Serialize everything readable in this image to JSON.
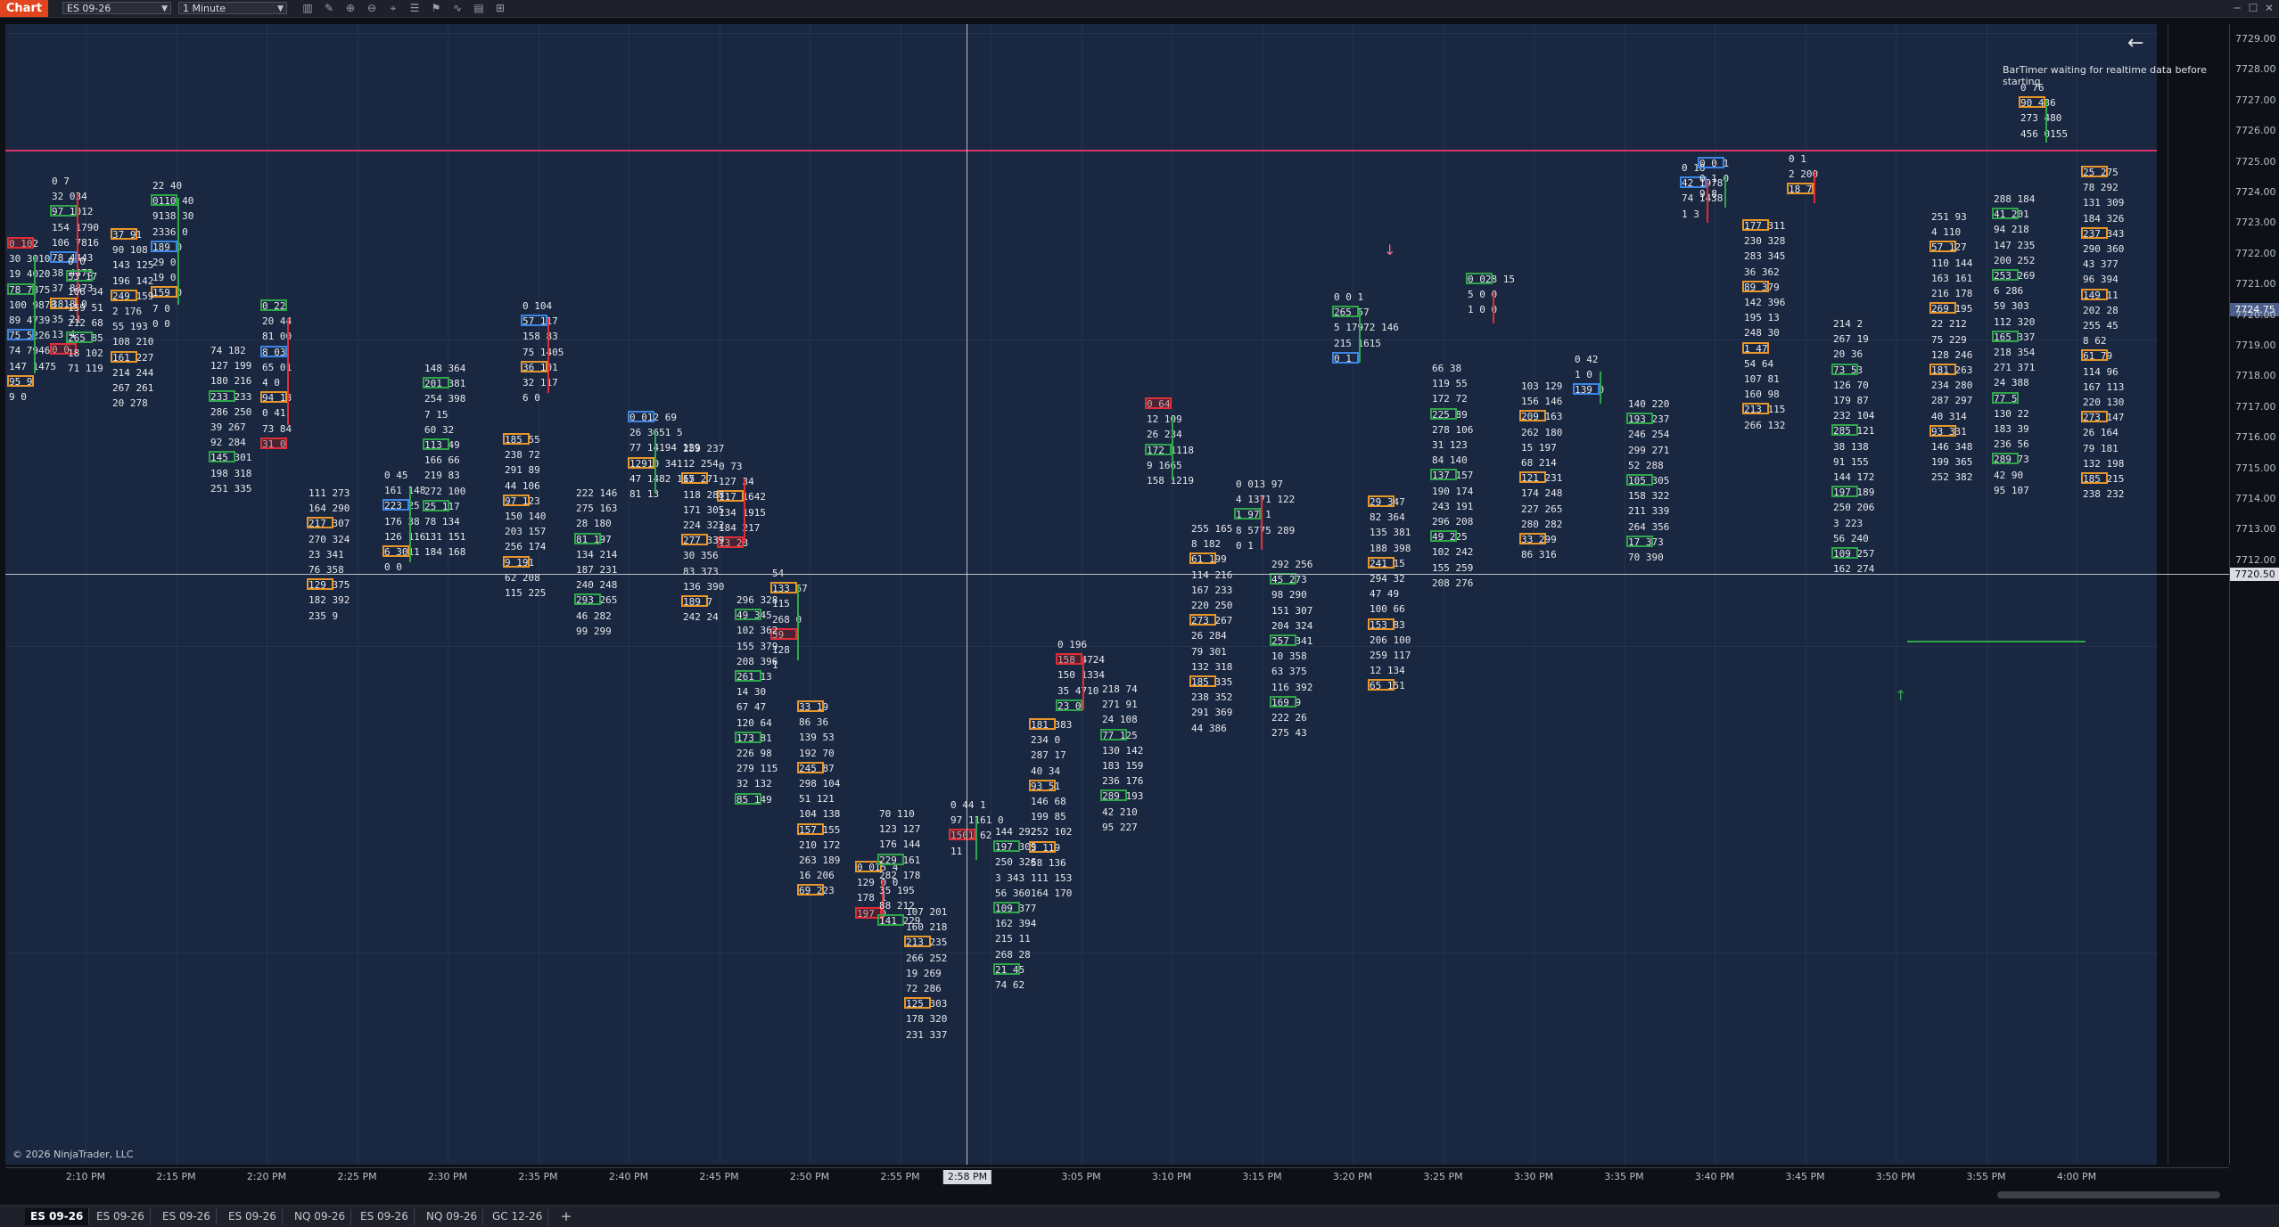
{
  "toolbar": {
    "chart_tab": "Chart",
    "instrument": "ES 09-26",
    "interval": "1 Minute",
    "icons": [
      "bar-style-icon",
      "draw-pencil-icon",
      "zoom-in-icon",
      "zoom-out-icon",
      "crosshair-icon",
      "properties-icon",
      "strategy-icon",
      "indicator-icon",
      "template-icon",
      "data-box-icon"
    ]
  },
  "chart": {
    "copyright": "© 2026 NinjaTrader, LLC",
    "bartimer": "BarTimer waiting for realtime data before starting",
    "price_labels": [
      "7729.00",
      "7728.00",
      "7727.00",
      "7726.00",
      "7725.00",
      "7724.00",
      "7723.00",
      "7722.00",
      "7721.00",
      "7720.00",
      "7719.00",
      "7718.00",
      "7717.00",
      "7716.00",
      "7715.00",
      "7714.00",
      "7713.00",
      "7712.00"
    ],
    "price_marker": "7724.75",
    "cursor_price": "7720.50",
    "time_labels": [
      "2:10 PM",
      "2:15 PM",
      "2:20 PM",
      "2:25 PM",
      "2:30 PM",
      "2:35 PM",
      "2:40 PM",
      "2:45 PM",
      "2:50 PM",
      "2:55 PM",
      "3:00 PM",
      "3:05 PM",
      "3:10 PM",
      "3:15 PM",
      "3:20 PM",
      "3:25 PM",
      "3:30 PM",
      "3:35 PM",
      "3:40 PM",
      "3:45 PM",
      "3:50 PM",
      "3:55 PM",
      "4:00 PM"
    ],
    "cursor_time": "2:58 PM",
    "colors": {
      "background": "#1a2740",
      "sell_imbalance": "#e12d35",
      "buy_imbalance": "#2fa64a",
      "poc": "#e9962a",
      "value": "#3c87e6",
      "level_line": "#d6336c"
    }
  },
  "tabs": [
    "ES 09-26",
    "ES 09-26",
    "ES 09-26",
    "ES 09-26",
    "NQ 09-26",
    "ES 09-26",
    "NQ 09-26",
    "GC 12-26"
  ],
  "footprint": [
    {
      "id": "c1",
      "col": [
        [
          "0",
          "102"
        ],
        [
          "30",
          "3010"
        ],
        [
          "19",
          "4020"
        ],
        [
          "78",
          "7875"
        ],
        [
          "100",
          "9878"
        ],
        [
          "89",
          "4739"
        ],
        [
          "75",
          "5226"
        ],
        [
          "74",
          "7946"
        ],
        [
          "147",
          "1475"
        ],
        [
          "95",
          "9"
        ],
        [
          "9",
          "0"
        ]
      ]
    },
    {
      "id": "c2",
      "col": [
        [
          "0",
          "7"
        ],
        [
          "32",
          "034"
        ],
        [
          "97",
          "1012"
        ],
        [
          "154",
          "1790"
        ],
        [
          "106",
          "7816"
        ],
        [
          "78",
          "4443"
        ],
        [
          "38",
          "4473"
        ],
        [
          "37",
          "8873"
        ],
        [
          "3818",
          "0"
        ],
        [
          "35",
          "21"
        ],
        [
          "13",
          "4"
        ],
        [
          "0",
          "0"
        ]
      ]
    },
    {
      "id": "c3",
      "col": [
        [
          "22",
          "40"
        ],
        [
          "0110",
          "40"
        ],
        [
          "9138",
          "30"
        ],
        [
          "2336",
          "0"
        ],
        [
          "189",
          "0"
        ],
        [
          "29",
          "0"
        ],
        [
          "19",
          "0"
        ],
        [
          "159",
          "0"
        ],
        [
          "7",
          "0"
        ],
        [
          "0",
          "0"
        ]
      ]
    },
    {
      "id": "c4",
      "col": [
        [
          "0",
          "22"
        ],
        [
          "20",
          "44"
        ],
        [
          "81",
          "00"
        ],
        [
          "8",
          "03"
        ],
        [
          "65",
          "01"
        ],
        [
          "4",
          "0"
        ],
        [
          "94",
          "18"
        ],
        [
          "0",
          "41"
        ],
        [
          "73",
          "84"
        ],
        [
          "31",
          "0"
        ]
      ]
    },
    {
      "id": "c5",
      "col": [
        [
          "0",
          "45"
        ],
        [
          "161",
          "148"
        ],
        [
          "223",
          "25"
        ],
        [
          "176",
          "38"
        ],
        [
          "126",
          "116"
        ],
        [
          "6",
          "3011"
        ],
        [
          "0",
          "0"
        ]
      ]
    },
    {
      "id": "c6",
      "col": [
        [
          "0",
          "104"
        ],
        [
          "57",
          "117"
        ],
        [
          "158",
          "83"
        ],
        [
          "75",
          "1405"
        ],
        [
          "36",
          "101"
        ],
        [
          "32",
          "117"
        ],
        [
          "6",
          "0"
        ]
      ]
    },
    {
      "id": "c7",
      "col": [
        [
          "0",
          "012",
          "69"
        ],
        [
          "26",
          "3651",
          "5"
        ],
        [
          "77",
          "14194",
          "129"
        ],
        [
          "12910",
          "341"
        ],
        [
          "47",
          "1482",
          "117"
        ],
        [
          "81",
          "13"
        ]
      ]
    },
    {
      "id": "c8",
      "col": [
        [
          "0",
          "73"
        ],
        [
          "127",
          "34"
        ],
        [
          "117",
          "1642"
        ],
        [
          "134",
          "1915"
        ],
        [
          "184",
          "217"
        ],
        [
          "13",
          "28"
        ]
      ]
    },
    {
      "id": "c9",
      "col": [
        [
          "54"
        ],
        [
          "133",
          "67"
        ],
        [
          "115"
        ],
        [
          "268",
          "0"
        ],
        [
          "59"
        ],
        [
          "128"
        ],
        [
          "1"
        ]
      ]
    },
    {
      "id": "c10",
      "col": [
        [
          "0",
          "015",
          "4"
        ],
        [
          "129",
          "0",
          "0"
        ],
        [
          "178",
          "1"
        ],
        [
          "197",
          "0"
        ]
      ]
    },
    {
      "id": "c11",
      "col": [
        [
          "0",
          "44",
          "1"
        ],
        [
          "97",
          "1161",
          "0"
        ],
        [
          "1501",
          "62"
        ],
        [
          "11"
        ]
      ]
    },
    {
      "id": "c12",
      "col": [
        [
          "0",
          "196"
        ],
        [
          "158",
          "4724"
        ],
        [
          "150",
          "1334"
        ],
        [
          "35",
          "4710"
        ],
        [
          "23",
          "0"
        ]
      ]
    },
    {
      "id": "c13",
      "col": [
        [
          "0",
          "64"
        ],
        [
          "12",
          "109"
        ],
        [
          "26",
          "234"
        ],
        [
          "172",
          "1118"
        ],
        [
          "9",
          "1665"
        ],
        [
          "158",
          "1219"
        ]
      ]
    },
    {
      "id": "c14",
      "col": [
        [
          "0",
          "013",
          "97"
        ],
        [
          "4",
          "1371",
          "122"
        ],
        [
          "1",
          "97",
          "1"
        ],
        [
          "8",
          "5775",
          "289"
        ],
        [
          "0",
          "1"
        ]
      ]
    },
    {
      "id": "c15",
      "col": [
        [
          "0",
          "0",
          "1"
        ],
        [
          "265",
          "57"
        ],
        [
          "5",
          "17972",
          "146"
        ],
        [
          "215",
          "1615"
        ],
        [
          "0",
          "1"
        ]
      ]
    },
    {
      "id": "c16",
      "col": [
        [
          "0",
          "028",
          "15"
        ],
        [
          "5",
          "0",
          "0"
        ],
        [
          "1",
          "0",
          "0"
        ]
      ]
    },
    {
      "id": "c17",
      "col": [
        [
          "0",
          "42"
        ],
        [
          "1",
          "0"
        ],
        [
          "139",
          "0"
        ]
      ]
    },
    {
      "id": "c18",
      "col": [
        [
          "0",
          "18"
        ],
        [
          "42",
          "1978"
        ],
        [
          "74",
          "1438"
        ],
        [
          "1",
          "3"
        ]
      ]
    },
    {
      "id": "c19",
      "col": [
        [
          "0",
          "0",
          "1"
        ],
        [
          "0",
          "1",
          "0"
        ],
        [
          "9",
          "8"
        ]
      ]
    },
    {
      "id": "c20",
      "col": [
        [
          "0",
          "1"
        ],
        [
          "2",
          "200"
        ],
        [
          "18",
          "7"
        ]
      ]
    },
    {
      "id": "c21",
      "col": [
        [
          "0",
          "76"
        ],
        [
          "90",
          "436"
        ],
        [
          "273",
          "480"
        ],
        [
          "456",
          "0155"
        ]
      ]
    }
  ]
}
